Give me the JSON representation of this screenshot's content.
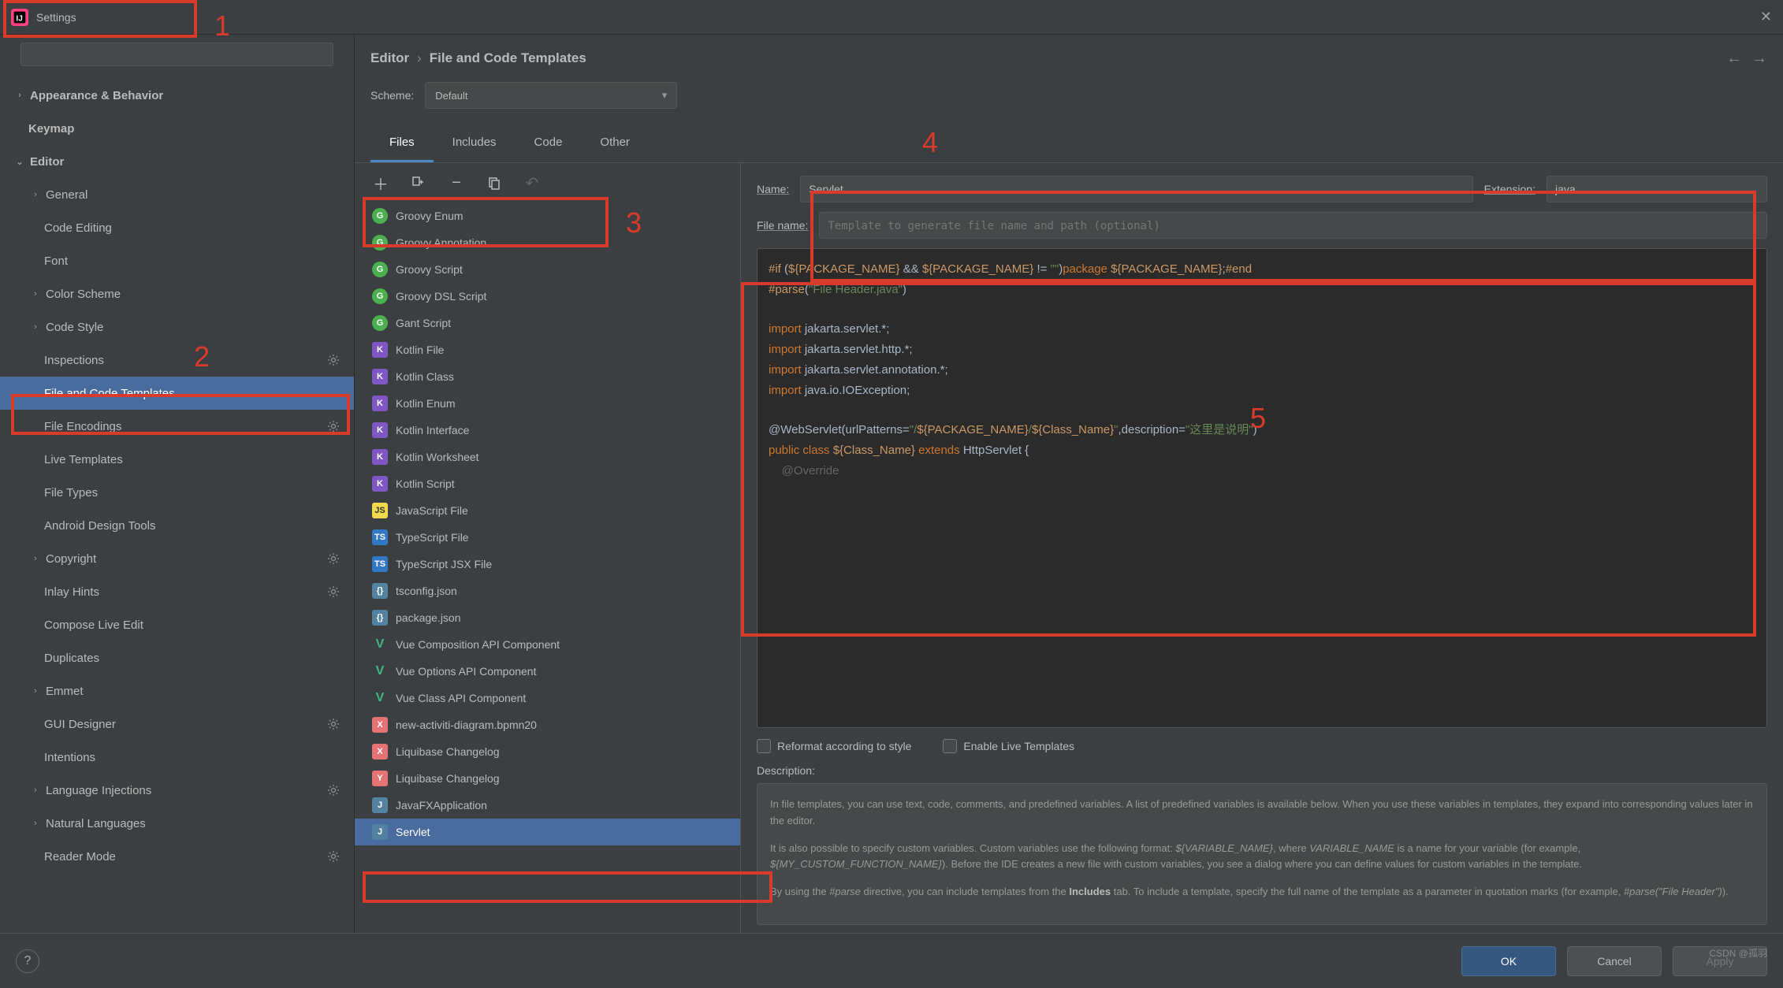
{
  "window": {
    "title": "Settings"
  },
  "sidebar": {
    "search_placeholder": "",
    "items": [
      {
        "label": "Appearance & Behavior",
        "depth": 0,
        "chev": ">",
        "bold": true
      },
      {
        "label": "Keymap",
        "depth": 0,
        "bold": true
      },
      {
        "label": "Editor",
        "depth": 0,
        "chev": "v",
        "bold": true
      },
      {
        "label": "General",
        "depth": 1,
        "chev": ">"
      },
      {
        "label": "Code Editing",
        "depth": 1
      },
      {
        "label": "Font",
        "depth": 1
      },
      {
        "label": "Color Scheme",
        "depth": 1,
        "chev": ">"
      },
      {
        "label": "Code Style",
        "depth": 1,
        "chev": ">"
      },
      {
        "label": "Inspections",
        "depth": 1,
        "gear": true
      },
      {
        "label": "File and Code Templates",
        "depth": 1,
        "selected": true
      },
      {
        "label": "File Encodings",
        "depth": 1,
        "gear": true
      },
      {
        "label": "Live Templates",
        "depth": 1
      },
      {
        "label": "File Types",
        "depth": 1
      },
      {
        "label": "Android Design Tools",
        "depth": 1
      },
      {
        "label": "Copyright",
        "depth": 1,
        "chev": ">",
        "gear": true
      },
      {
        "label": "Inlay Hints",
        "depth": 1,
        "gear": true
      },
      {
        "label": "Compose Live Edit",
        "depth": 1
      },
      {
        "label": "Duplicates",
        "depth": 1
      },
      {
        "label": "Emmet",
        "depth": 1,
        "chev": ">"
      },
      {
        "label": "GUI Designer",
        "depth": 1,
        "gear": true
      },
      {
        "label": "Intentions",
        "depth": 1
      },
      {
        "label": "Language Injections",
        "depth": 1,
        "chev": ">",
        "gear": true
      },
      {
        "label": "Natural Languages",
        "depth": 1,
        "chev": ">"
      },
      {
        "label": "Reader Mode",
        "depth": 1,
        "gear": true
      }
    ]
  },
  "breadcrumb": {
    "a": "Editor",
    "b": "File and Code Templates"
  },
  "scheme": {
    "label": "Scheme:",
    "value": "Default"
  },
  "tabs": [
    {
      "label": "Files",
      "active": true
    },
    {
      "label": "Includes"
    },
    {
      "label": "Code"
    },
    {
      "label": "Other"
    }
  ],
  "templates": [
    {
      "label": "Groovy Enum",
      "icon": "G",
      "iconClass": "ico-g"
    },
    {
      "label": "Groovy Annotation",
      "icon": "G",
      "iconClass": "ico-g"
    },
    {
      "label": "Groovy Script",
      "icon": "G",
      "iconClass": "ico-g"
    },
    {
      "label": "Groovy DSL Script",
      "icon": "G",
      "iconClass": "ico-g"
    },
    {
      "label": "Gant Script",
      "icon": "G",
      "iconClass": "ico-g"
    },
    {
      "label": "Kotlin File",
      "icon": "K",
      "iconClass": "ico-k"
    },
    {
      "label": "Kotlin Class",
      "icon": "K",
      "iconClass": "ico-k"
    },
    {
      "label": "Kotlin Enum",
      "icon": "K",
      "iconClass": "ico-k"
    },
    {
      "label": "Kotlin Interface",
      "icon": "K",
      "iconClass": "ico-k"
    },
    {
      "label": "Kotlin Worksheet",
      "icon": "K",
      "iconClass": "ico-k"
    },
    {
      "label": "Kotlin Script",
      "icon": "K",
      "iconClass": "ico-k"
    },
    {
      "label": "JavaScript File",
      "icon": "JS",
      "iconClass": "ico-js"
    },
    {
      "label": "TypeScript File",
      "icon": "TS",
      "iconClass": "ico-ts"
    },
    {
      "label": "TypeScript JSX File",
      "icon": "TS",
      "iconClass": "ico-ts"
    },
    {
      "label": "tsconfig.json",
      "icon": "{}",
      "iconClass": "ico-json"
    },
    {
      "label": "package.json",
      "icon": "{}",
      "iconClass": "ico-json"
    },
    {
      "label": "Vue Composition API Component",
      "icon": "V",
      "iconClass": "ico-vue"
    },
    {
      "label": "Vue Options API Component",
      "icon": "V",
      "iconClass": "ico-vue"
    },
    {
      "label": "Vue Class API Component",
      "icon": "V",
      "iconClass": "ico-vue"
    },
    {
      "label": "new-activiti-diagram.bpmn20",
      "icon": "X",
      "iconClass": "ico-xml"
    },
    {
      "label": "Liquibase Changelog",
      "icon": "X",
      "iconClass": "ico-xml"
    },
    {
      "label": "Liquibase Changelog",
      "icon": "Y",
      "iconClass": "ico-xml"
    },
    {
      "label": "JavaFXApplication",
      "icon": "J",
      "iconClass": "ico-j"
    },
    {
      "label": "Servlet",
      "icon": "J",
      "iconClass": "ico-j",
      "selected": true
    }
  ],
  "fields": {
    "name_label": "Name:",
    "name_value": "Servlet",
    "ext_label": "Extension:",
    "ext_value": "java",
    "fname_label": "File name:",
    "fname_placeholder": "Template to generate file name and path (optional)"
  },
  "code": {
    "l1a": "#if",
    "l1b": " (",
    "l1c": "${PACKAGE_NAME}",
    "l1d": " && ",
    "l1e": "${PACKAGE_NAME}",
    "l1f": " != ",
    "l1g": "\"\"",
    "l1h": ")",
    "l1i": "package ",
    "l1j": "${PACKAGE_NAME}",
    "l1k": ";",
    "l1l": "#end",
    "l2a": "#parse",
    "l2b": "(",
    "l2c": "\"File Header.java\"",
    "l2d": ")",
    "l4a": "import ",
    "l4b": "jakarta.servlet.*;",
    "l5a": "import ",
    "l5b": "jakarta.servlet.http.*;",
    "l6a": "import ",
    "l6b": "jakarta.servlet.annotation.*;",
    "l7a": "import ",
    "l7b": "java.io.IOException;",
    "l9a": "@WebServlet(urlPatterns=",
    "l9b": "\"/",
    "l9c": "${PACKAGE_NAME}",
    "l9d": "/",
    "l9e": "${Class_Name}",
    "l9f": "\"",
    "l9g": ",description=",
    "l9h": "\"这里是说明\"",
    "l9i": ")",
    "l10a": "public class ",
    "l10b": "${Class_Name}",
    "l10c": " extends ",
    "l10d": "HttpServlet {",
    "l11a": "    @Override"
  },
  "options": {
    "reformat": "Reformat according to style",
    "livetmpl": "Enable Live Templates"
  },
  "description": {
    "label": "Description:",
    "p1": "In file templates, you can use text, code, comments, and predefined variables. A list of predefined variables is available below. When you use these variables in templates, they expand into corresponding values later in the editor.",
    "p2a": "It is also possible to specify custom variables. Custom variables use the following format: ",
    "p2b": "${VARIABLE_NAME}",
    "p2c": ", where ",
    "p2d": "VARIABLE_NAME",
    "p2e": " is a name for your variable (for example, ",
    "p2f": "${MY_CUSTOM_FUNCTION_NAME}",
    "p2g": "). Before the IDE creates a new file with custom variables, you see a dialog where you can define values for custom variables in the template.",
    "p3a": "By using the ",
    "p3b": "#parse",
    "p3c": " directive, you can include templates from the ",
    "p3d": "Includes",
    "p3e": " tab. To include a template, specify the full name of the template as a parameter in quotation marks (for example, ",
    "p3f": "#parse(\"File Header\")",
    "p3g": ")."
  },
  "footer": {
    "ok": "OK",
    "cancel": "Cancel",
    "apply": "Apply"
  },
  "annotations": {
    "n1": "1",
    "n2": "2",
    "n3": "3",
    "n4": "4",
    "n5": "5"
  },
  "watermark": "CSDN @孤羽"
}
